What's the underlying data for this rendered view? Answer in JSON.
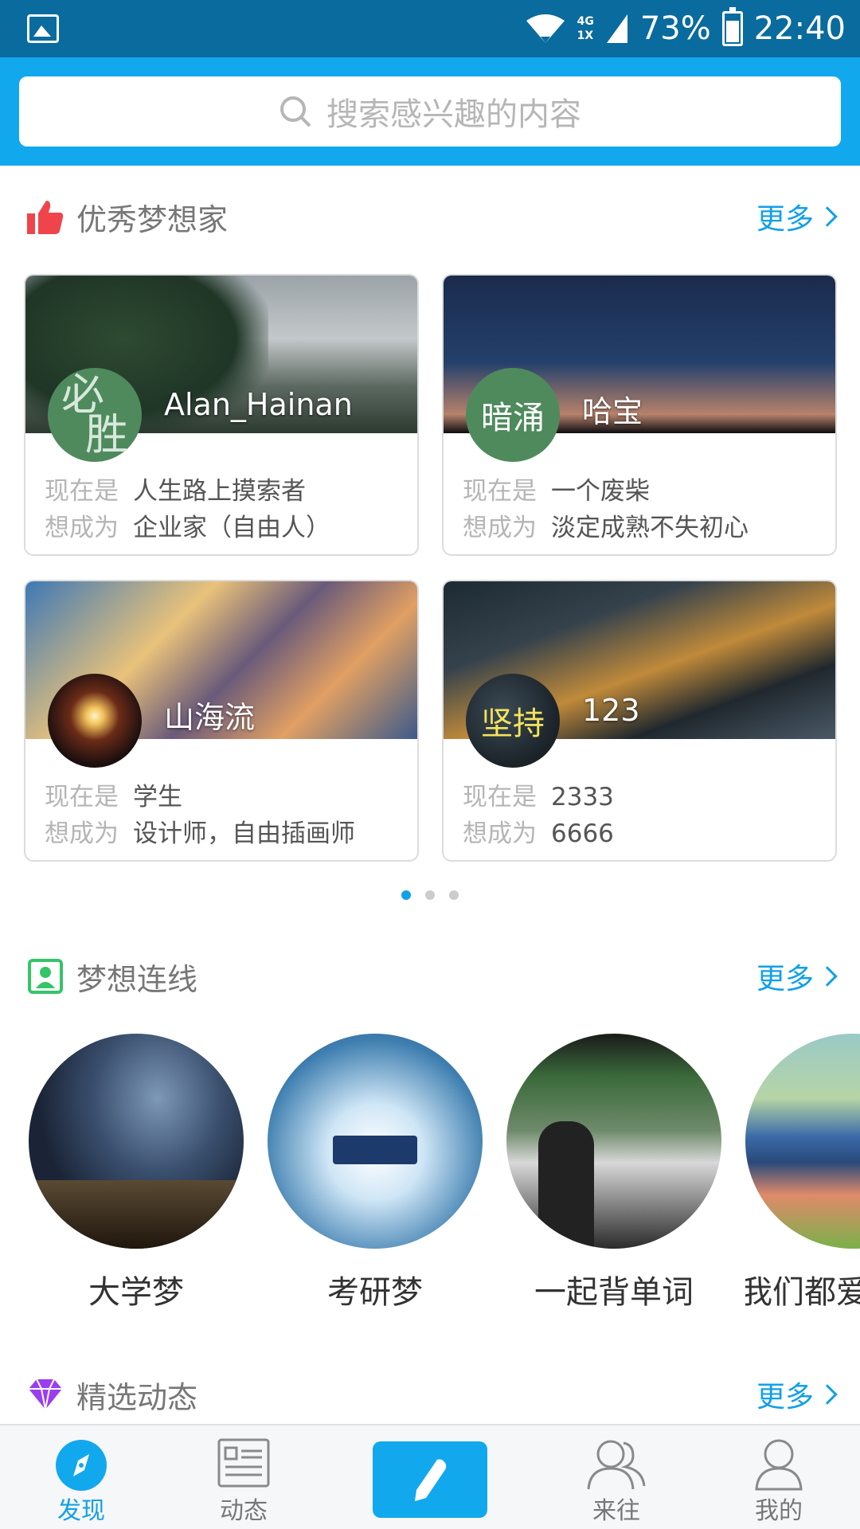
{
  "status_bar": {
    "network_top": "4G",
    "network_bottom": "1X",
    "battery": "73%",
    "time": "22:40"
  },
  "search": {
    "placeholder": "搜索感兴趣的内容"
  },
  "dreamers_section": {
    "title": "优秀梦想家",
    "more": "更多",
    "cards": [
      {
        "avatar_text_1": "必",
        "avatar_text_2": "胜",
        "name": "Alan_Hainan",
        "now_key": "现在是",
        "now": "人生路上摸索者",
        "want_key": "想成为",
        "want": "企业家（自由人）"
      },
      {
        "avatar_text": "暗涌",
        "name": "哈宝",
        "now_key": "现在是",
        "now": "一个废柴",
        "want_key": "想成为",
        "want": "淡定成熟不失初心"
      },
      {
        "name": "山海流",
        "now_key": "现在是",
        "now": "学生",
        "want_key": "想成为",
        "want": "设计师，自由插画师"
      },
      {
        "avatar_text": "坚持",
        "name": "123",
        "now_key": "现在是",
        "now": "2333",
        "want_key": "想成为",
        "want": "6666"
      }
    ],
    "pager": {
      "pages": 3,
      "current": 1
    }
  },
  "dream_line_section": {
    "title": "梦想连线",
    "more": "更多",
    "items": [
      {
        "label": "大学梦"
      },
      {
        "label": "考研梦"
      },
      {
        "label": "一起背单词"
      },
      {
        "label": "我们都爱"
      }
    ]
  },
  "featured_section": {
    "title": "精选动态",
    "more": "更多"
  },
  "bottom_nav": {
    "items": [
      {
        "label": "发现",
        "icon": "compass-icon",
        "active": true
      },
      {
        "label": "动态",
        "icon": "news-icon",
        "active": false
      },
      {
        "label": "",
        "icon": "pencil-icon",
        "active": false
      },
      {
        "label": "来往",
        "icon": "contacts-icon",
        "active": false
      },
      {
        "label": "我的",
        "icon": "profile-icon",
        "active": false
      }
    ]
  },
  "colors": {
    "status_bar": "#0a6b9e",
    "accent": "#12a8ee",
    "link": "#12a0e8",
    "like_red": "#f0444b",
    "contact_green": "#34c46a",
    "diamond_purple": "#9b3df0"
  }
}
